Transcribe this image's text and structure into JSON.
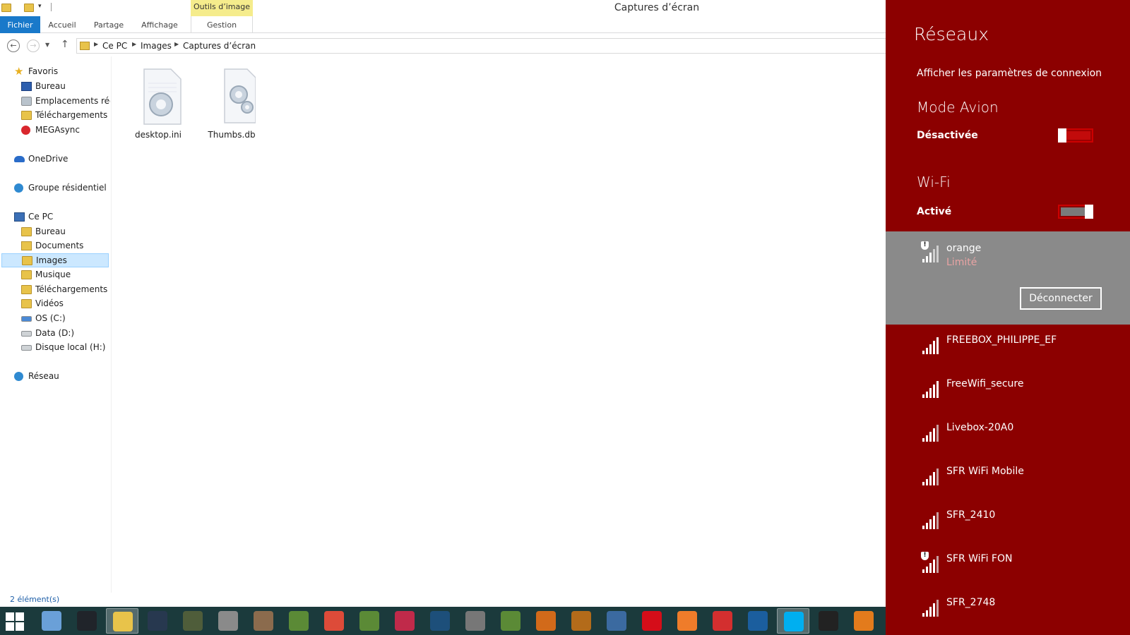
{
  "window": {
    "title": "Captures d’écran",
    "context_tab_group": "Outils d’image"
  },
  "ribbon": {
    "tabs": [
      "Fichier",
      "Accueil",
      "Partage",
      "Affichage",
      "Gestion"
    ]
  },
  "address": {
    "crumbs": [
      "Ce PC",
      "Images",
      "Captures d’écran"
    ]
  },
  "nav": {
    "favorites": {
      "label": "Favoris",
      "items": [
        "Bureau",
        "Emplacements récents",
        "Téléchargements",
        "MEGAsync"
      ]
    },
    "onedrive": "OneDrive",
    "homegroup": "Groupe résidentiel",
    "thispc": {
      "label": "Ce PC",
      "items": [
        "Bureau",
        "Documents",
        "Images",
        "Musique",
        "Téléchargements",
        "Vidéos",
        "OS (C:)",
        "Data (D:)",
        "Disque local (H:)"
      ]
    },
    "network": "Réseau",
    "selected": "Images"
  },
  "files": [
    {
      "name": "desktop.ini",
      "icon": "settings-file-icon"
    },
    {
      "name": "Thumbs.db",
      "icon": "settings-file-icon"
    }
  ],
  "status": {
    "count": "2 élément(s)"
  },
  "taskbar": {
    "apps": [
      {
        "name": "keyboard-app",
        "color": "#6aa0d8"
      },
      {
        "name": "pictures-app",
        "color": "#20242a"
      },
      {
        "name": "file-explorer",
        "color": "#e8c34a",
        "active": true
      },
      {
        "name": "steam",
        "color": "#27384f"
      },
      {
        "name": "radeon-app",
        "color": "#4f5d3a"
      },
      {
        "name": "monitor-app",
        "color": "#8a8a8a"
      },
      {
        "name": "toolbox-app",
        "color": "#8b6b4d"
      },
      {
        "name": "minecraft",
        "color": "#5b8a36"
      },
      {
        "name": "chrome",
        "color": "#dd4b39"
      },
      {
        "name": "minecraft-2",
        "color": "#5b8a36"
      },
      {
        "name": "game-app",
        "color": "#c02a4a"
      },
      {
        "name": "league-of-legends",
        "color": "#1d4f7a"
      },
      {
        "name": "controller-app",
        "color": "#777"
      },
      {
        "name": "minecraft-3",
        "color": "#5b8a36"
      },
      {
        "name": "fire-app",
        "color": "#d26a1a"
      },
      {
        "name": "emblem-app",
        "color": "#b36b1a"
      },
      {
        "name": "audio-app",
        "color": "#3b6aa0"
      },
      {
        "name": "opera",
        "color": "#d50d19"
      },
      {
        "name": "mail-app",
        "color": "#ef7c2a"
      },
      {
        "name": "pokeball-app",
        "color": "#d32f2f"
      },
      {
        "name": "launcher-app",
        "color": "#1b5e9e"
      },
      {
        "name": "skype",
        "color": "#00aff0",
        "active": true
      },
      {
        "name": "chart-app",
        "color": "#222"
      },
      {
        "name": "wheel-app",
        "color": "#e37b1c"
      }
    ]
  },
  "charm": {
    "title": "Réseaux",
    "settings_link": "Afficher les paramètres de connexion",
    "airplane": {
      "title": "Mode Avion",
      "state": "Désactivée"
    },
    "wifi": {
      "title": "Wi-Fi",
      "state": "Activé"
    },
    "connected": {
      "name": "orange",
      "status": "Limité",
      "button": "Déconnecter",
      "signal_bars": 3
    },
    "networks": [
      {
        "name": "FREEBOX_PHILIPPE_EF",
        "signal_bars": 5,
        "secured_warning": false
      },
      {
        "name": "FreeWifi_secure",
        "signal_bars": 5,
        "secured_warning": false
      },
      {
        "name": "Livebox-20A0",
        "signal_bars": 4,
        "secured_warning": false
      },
      {
        "name": "SFR WiFi Mobile",
        "signal_bars": 4,
        "secured_warning": false
      },
      {
        "name": "SFR_2410",
        "signal_bars": 4,
        "secured_warning": false
      },
      {
        "name": "SFR WiFi FON",
        "signal_bars": 4,
        "secured_warning": true
      },
      {
        "name": "SFR_2748",
        "signal_bars": 4,
        "secured_warning": false
      }
    ]
  }
}
